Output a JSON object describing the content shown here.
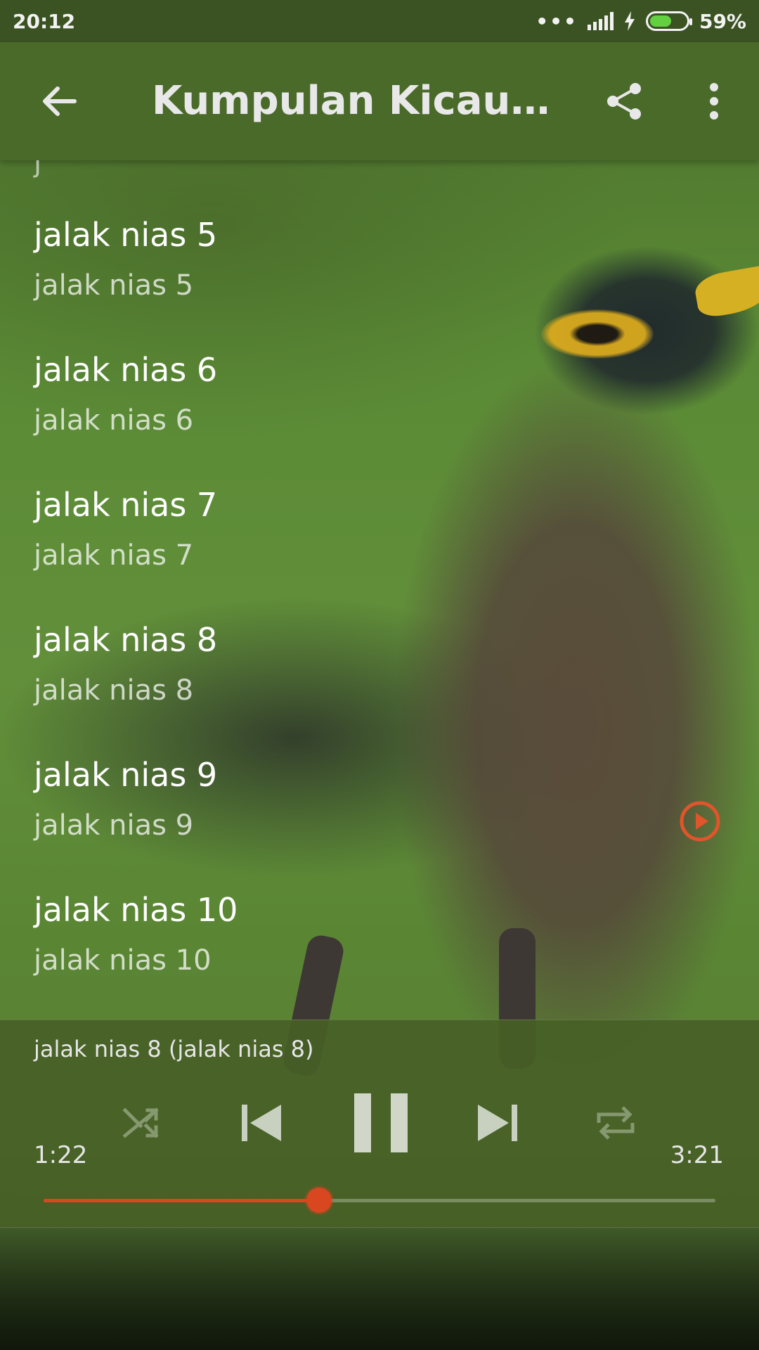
{
  "status_bar": {
    "time": "20:12",
    "dots": "•••",
    "battery_percent_text": "59%",
    "battery_level": 0.59,
    "battery_color": "#63d13f"
  },
  "app_bar": {
    "title": "Kumpulan Kicau Jal...",
    "back_icon": "arrow-left-icon",
    "share_icon": "share-icon",
    "more_icon": "more-vertical-icon",
    "color": "#4a6a2a"
  },
  "list": {
    "partial_top_item": "j",
    "items": [
      {
        "title": "jalak nias 5",
        "subtitle": "jalak nias 5"
      },
      {
        "title": "jalak nias 6",
        "subtitle": "jalak nias 6"
      },
      {
        "title": "jalak nias 7",
        "subtitle": "jalak nias 7"
      },
      {
        "title": "jalak nias 8",
        "subtitle": "jalak nias 8",
        "playing": true
      },
      {
        "title": "jalak nias 9",
        "subtitle": "jalak nias 9"
      },
      {
        "title": "jalak nias 10",
        "subtitle": "jalak nias 10"
      }
    ],
    "playing_indicator_icon": "play-circle-icon",
    "accent": "#e0552a"
  },
  "player": {
    "now_playing": "jalak nias 8 (jalak nias 8)",
    "elapsed": "1:22",
    "duration": "3:21",
    "progress": 0.41,
    "controls": [
      "shuffle-icon",
      "skip-previous-icon",
      "pause-icon",
      "skip-next-icon",
      "repeat-icon"
    ],
    "accent": "#d8471f"
  }
}
